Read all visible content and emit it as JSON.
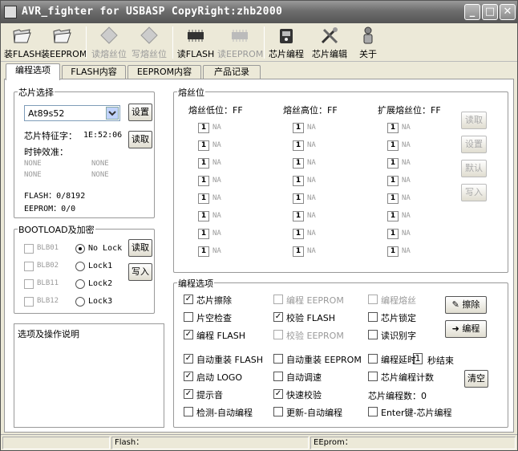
{
  "title": "AVR_fighter for USBASP CopyRight:zhb2000",
  "toolbar": [
    {
      "label": "装FLASH",
      "enabled": true,
      "icon": "folder-icon"
    },
    {
      "label": "装EEPROM",
      "enabled": true,
      "icon": "folder-icon"
    },
    {
      "label": "读熔丝位",
      "enabled": false,
      "icon": "diamond-icon"
    },
    {
      "label": "写熔丝位",
      "enabled": false,
      "icon": "diamond-icon"
    },
    {
      "label": "读FLASH",
      "enabled": true,
      "icon": "chip-icon"
    },
    {
      "label": "读EEPROM",
      "enabled": false,
      "icon": "chip-icon"
    },
    {
      "label": "芯片编程",
      "enabled": true,
      "icon": "programmer-icon"
    },
    {
      "label": "芯片编辑",
      "enabled": true,
      "icon": "tools-icon"
    },
    {
      "label": "关于",
      "enabled": true,
      "icon": "about-icon"
    }
  ],
  "tabs": [
    "编程选项",
    "FLASH内容",
    "EEPROM内容",
    "产品记录"
  ],
  "chip": {
    "group_label": "芯片选择",
    "selected": "At89s52",
    "set_btn": "设置",
    "read_btn": "读取",
    "signature_label": "芯片特征字：",
    "signature": "1E:52:06",
    "clock_label": "时钟效准：",
    "none_values": [
      "NONE",
      "NONE",
      "NONE",
      "NONE"
    ],
    "flash": "FLASH：0/8192",
    "eeprom": "EEPROM：0/0"
  },
  "boot": {
    "group_label": "BOOTLOAD及加密",
    "blb": [
      "BLB01",
      "BLB02",
      "BLB11",
      "BLB12"
    ],
    "locks": [
      "No Lock",
      "Lock1",
      "Lock2",
      "Lock3"
    ],
    "read_btn": "读取",
    "write_btn": "写入"
  },
  "notes_label": "选项及操作说明",
  "fuse": {
    "group_label": "熔丝位",
    "low": "熔丝低位：FF",
    "high": "熔丝高位：FF",
    "ext": "扩展熔丝位：FF",
    "bit_value": "1",
    "bit_text": "NA",
    "buttons": [
      "读取",
      "设置",
      "默认",
      "写入"
    ]
  },
  "options": {
    "group_label": "编程选项",
    "items": [
      {
        "label": "芯片擦除",
        "checked": true,
        "enabled": true
      },
      {
        "label": "编程 EEPROM",
        "checked": false,
        "enabled": false
      },
      {
        "label": "编程熔丝",
        "checked": false,
        "enabled": false
      },
      {
        "label": "片空检查",
        "checked": false,
        "enabled": true
      },
      {
        "label": "校验 FLASH",
        "checked": true,
        "enabled": true
      },
      {
        "label": "芯片锁定",
        "checked": false,
        "enabled": true
      },
      {
        "label": "编程 FLASH",
        "checked": true,
        "enabled": true
      },
      {
        "label": "校验 EEPROM",
        "checked": false,
        "enabled": false
      },
      {
        "label": "读识别字",
        "checked": false,
        "enabled": true
      },
      {
        "label": "自动重装 FLASH",
        "checked": true,
        "enabled": true
      },
      {
        "label": "自动重装 EEPROM",
        "checked": false,
        "enabled": true
      },
      {
        "label": "编程延时",
        "checked": false,
        "enabled": true
      },
      {
        "label": "启动 LOGO",
        "checked": true,
        "enabled": true
      },
      {
        "label": "自动调速",
        "checked": false,
        "enabled": true
      },
      {
        "label": "芯片编程计数",
        "checked": false,
        "enabled": true
      },
      {
        "label": "提示音",
        "checked": true,
        "enabled": true
      },
      {
        "label": "快速校验",
        "checked": true,
        "enabled": true
      },
      {
        "label": "检测-自动编程",
        "checked": false,
        "enabled": true
      },
      {
        "label": "更新-自动编程",
        "checked": false,
        "enabled": true
      },
      {
        "label": "Enter键-芯片编程",
        "checked": false,
        "enabled": true
      }
    ],
    "delay_value": "1",
    "delay_suffix": "秒结束",
    "count_text": "芯片编程数：0",
    "erase_btn": "擦除",
    "program_btn": "编程",
    "clear_btn": "清空"
  },
  "status": {
    "flash": "Flash：",
    "eeprom": "EEprom："
  }
}
